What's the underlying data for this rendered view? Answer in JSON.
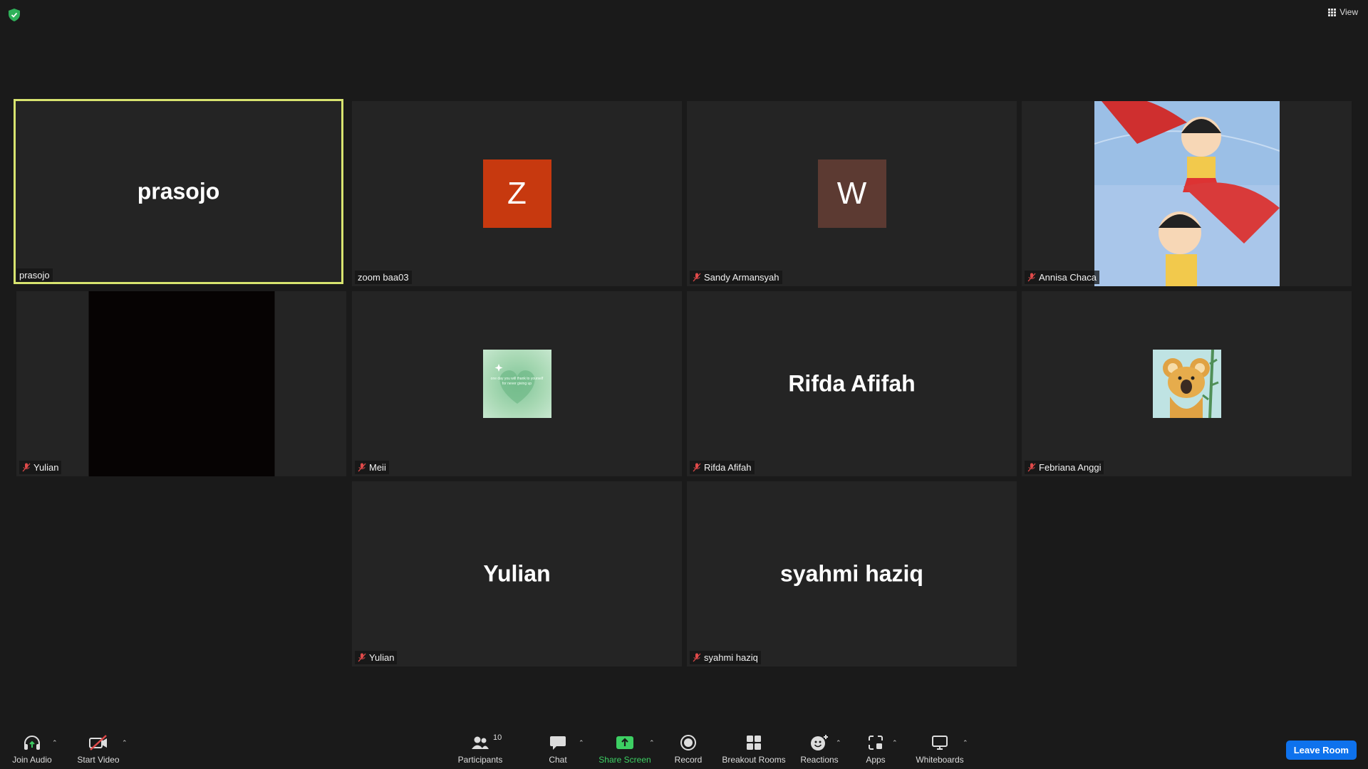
{
  "top": {
    "view_label": "View"
  },
  "tiles": [
    {
      "display": "prasojo",
      "label": "prasojo"
    },
    {
      "display": "Z",
      "label": "zoom baa03"
    },
    {
      "display": "W",
      "label": "Sandy Armansyah"
    },
    {
      "label": "Annisa Chaca"
    },
    {
      "label": "Yulian"
    },
    {
      "label": "Meii",
      "picture_text": "one day you will thank to yourself for never giving up"
    },
    {
      "display": "Rifda Afifah",
      "label": "Rifda Afifah"
    },
    {
      "label": "Febriana Anggi"
    },
    {
      "display": "Yulian",
      "label": "Yulian"
    },
    {
      "display": "syahmi haziq",
      "label": "syahmi haziq"
    }
  ],
  "toolbar": {
    "join_audio": "Join Audio",
    "start_video": "Start Video",
    "participants": "Participants",
    "participants_count": "10",
    "chat": "Chat",
    "share_screen": "Share Screen",
    "record": "Record",
    "breakout_rooms": "Breakout Rooms",
    "reactions": "Reactions",
    "apps": "Apps",
    "whiteboards": "Whiteboards",
    "leave_room": "Leave Room"
  },
  "colors": {
    "active_speaker_border": "#d7e36f",
    "avatar_z": "#c7390f",
    "avatar_w": "#5c3a32",
    "share_green": "#3dcf63",
    "leave_blue": "#0e72ed",
    "mute_red": "#e04a4a"
  }
}
